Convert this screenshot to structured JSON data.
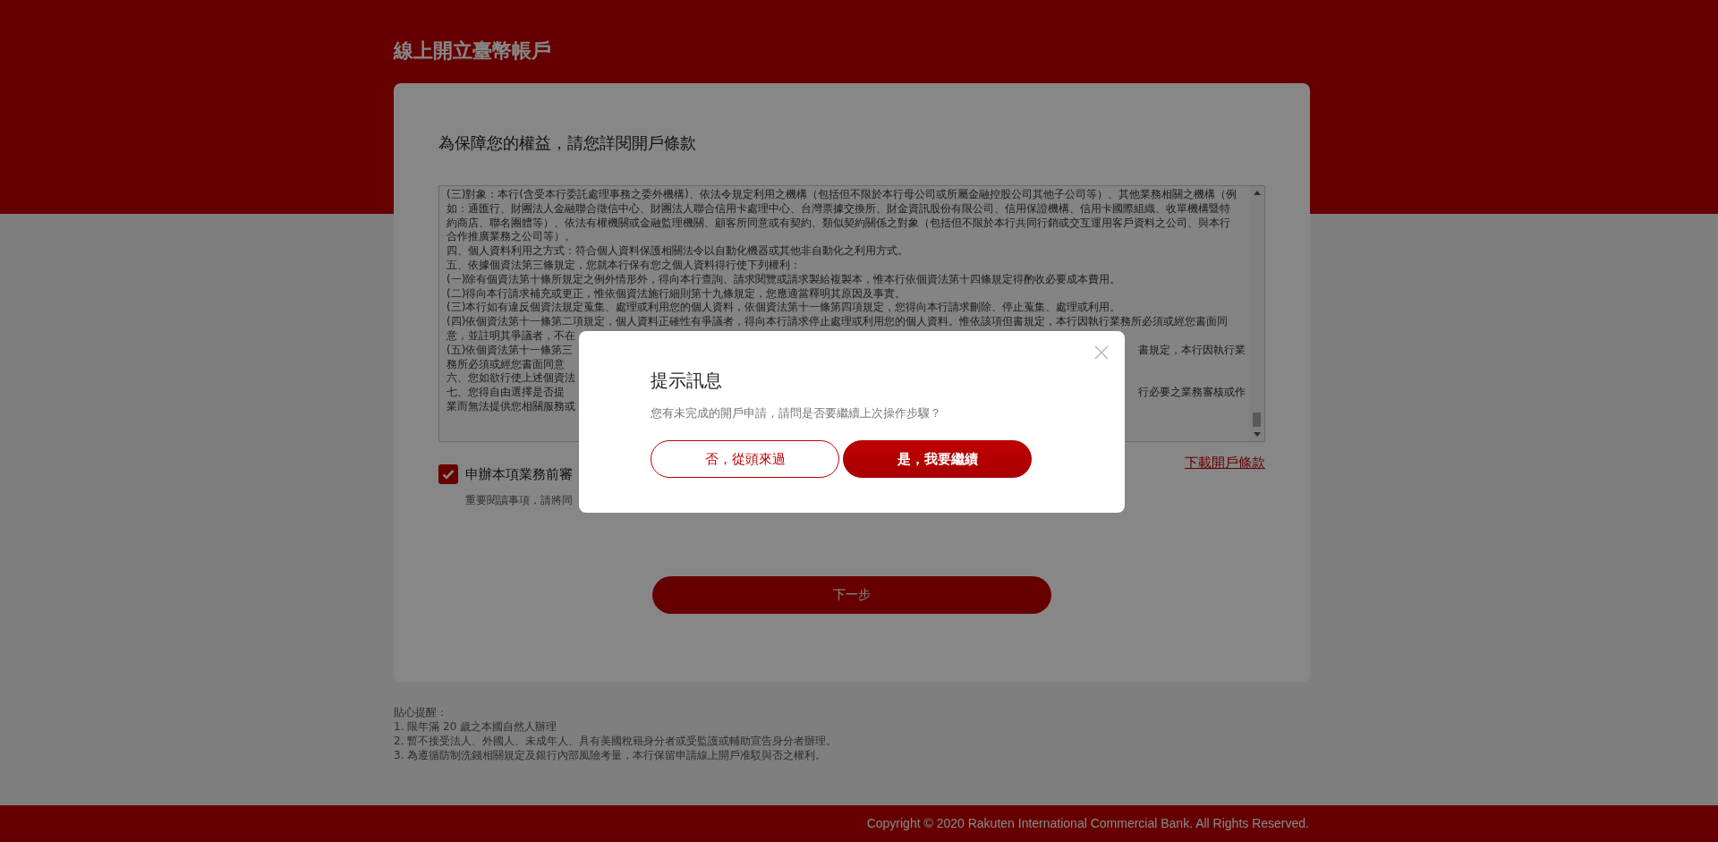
{
  "header": {
    "title": "線上開立臺幣帳戶"
  },
  "terms": {
    "heading": "為保障您的權益，請您詳閱開戶條款",
    "lines": [
      {
        "text": "(三)對象：本行(含受本行委託處理事務之委外機構)、依法令規定利用之機構（包括但不限於本行母公司或所屬金融控股公司其他子公司等）、其他業務相關之機構（例"
      },
      {
        "text": "如：通匯行、財團法人金融聯合徵信中心、財團法人聯合信用卡處理中心、台灣票據交換所、財金資訊股份有限公司、信用保證機構、信用卡國際組織、收單機構暨特"
      },
      {
        "text": "約商店、聯名團體等）、依法有權機關或金融監理機關、顧客所同意或有契約、類似契約關係之對象（包括但不限於本行共同行銷或交互運用客戶資料之公司、與本行"
      },
      {
        "text": "合作推廣業務之公司等）。"
      },
      {
        "text": "四、個人資料利用之方式：符合個人資料保護相關法令以自動化機器或其他非自動化之利用方式。"
      },
      {
        "text": "五、依據個資法第三條規定，您就本行保有您之個人資料得行使下列權利："
      },
      {
        "text": "(一)除有個資法第十條所規定之例外情形外，得向本行查詢、請求閱覽或請求製給複製本，惟本行依個資法第十四條規定得酌收必要成本費用。"
      },
      {
        "text": "(二)得向本行請求補充或更正，惟依個資法施行細則第十九條規定，您應適當釋明其原因及事實。"
      },
      {
        "text": "(三)本行如有違反個資法規定蒐集、處理或利用您的個人資料，依個資法第十一條第四項規定，您得向本行請求刪除、停止蒐集、處理或利用。"
      },
      {
        "text": "(四)依個資法第十一條第二項規定，個人資料正確性有爭議者，得向本行請求停止處理或利用您的個人資料。惟依該項但書規定，本行因執行業務所必須或經您書面同"
      },
      {
        "left": "意，並註明其爭議者，不在"
      },
      {
        "left": "(五)依個資法第十一條第三",
        "right": "書規定，本行因執行業"
      },
      {
        "left": "務所必須或經您書面同意"
      },
      {
        "left": "六、您如欲行使上述個資法"
      },
      {
        "left": "七、您得自由選擇是否提",
        "right": "行必要之業務審核或作"
      },
      {
        "left": "業而無法提供您相關服務或"
      }
    ],
    "download_link": "下載開戶條款"
  },
  "agreement": {
    "label": "申辦本項業務前審",
    "checked": true,
    "note": "重要閱讀事項，請將同"
  },
  "next_button": "下一步",
  "tips": {
    "title": "貼心提醒：",
    "items": [
      "1. 限年滿 20 歲之本國自然人辦理",
      "2. 暫不接受法人、外國人、未成年人、具有美國稅籍身分者或受監護或輔助宣告身分者辦理。",
      "3. 為遵循防制洗錢相關規定及銀行內部風險考量，本行保留申請線上開戶准駁與否之權利。"
    ]
  },
  "footer": {
    "copyright": "Copyright © 2020 Rakuten International Commercial Bank. All Rights Reserved."
  },
  "dialog": {
    "title": "提示訊息",
    "message": "您有未完成的開戶申請，請問是否要繼續上次操作步驟？",
    "buttons": [
      {
        "label": "否，從頭來過",
        "kind": "outline"
      },
      {
        "label": "是，我要繼續",
        "kind": "primary"
      }
    ]
  }
}
